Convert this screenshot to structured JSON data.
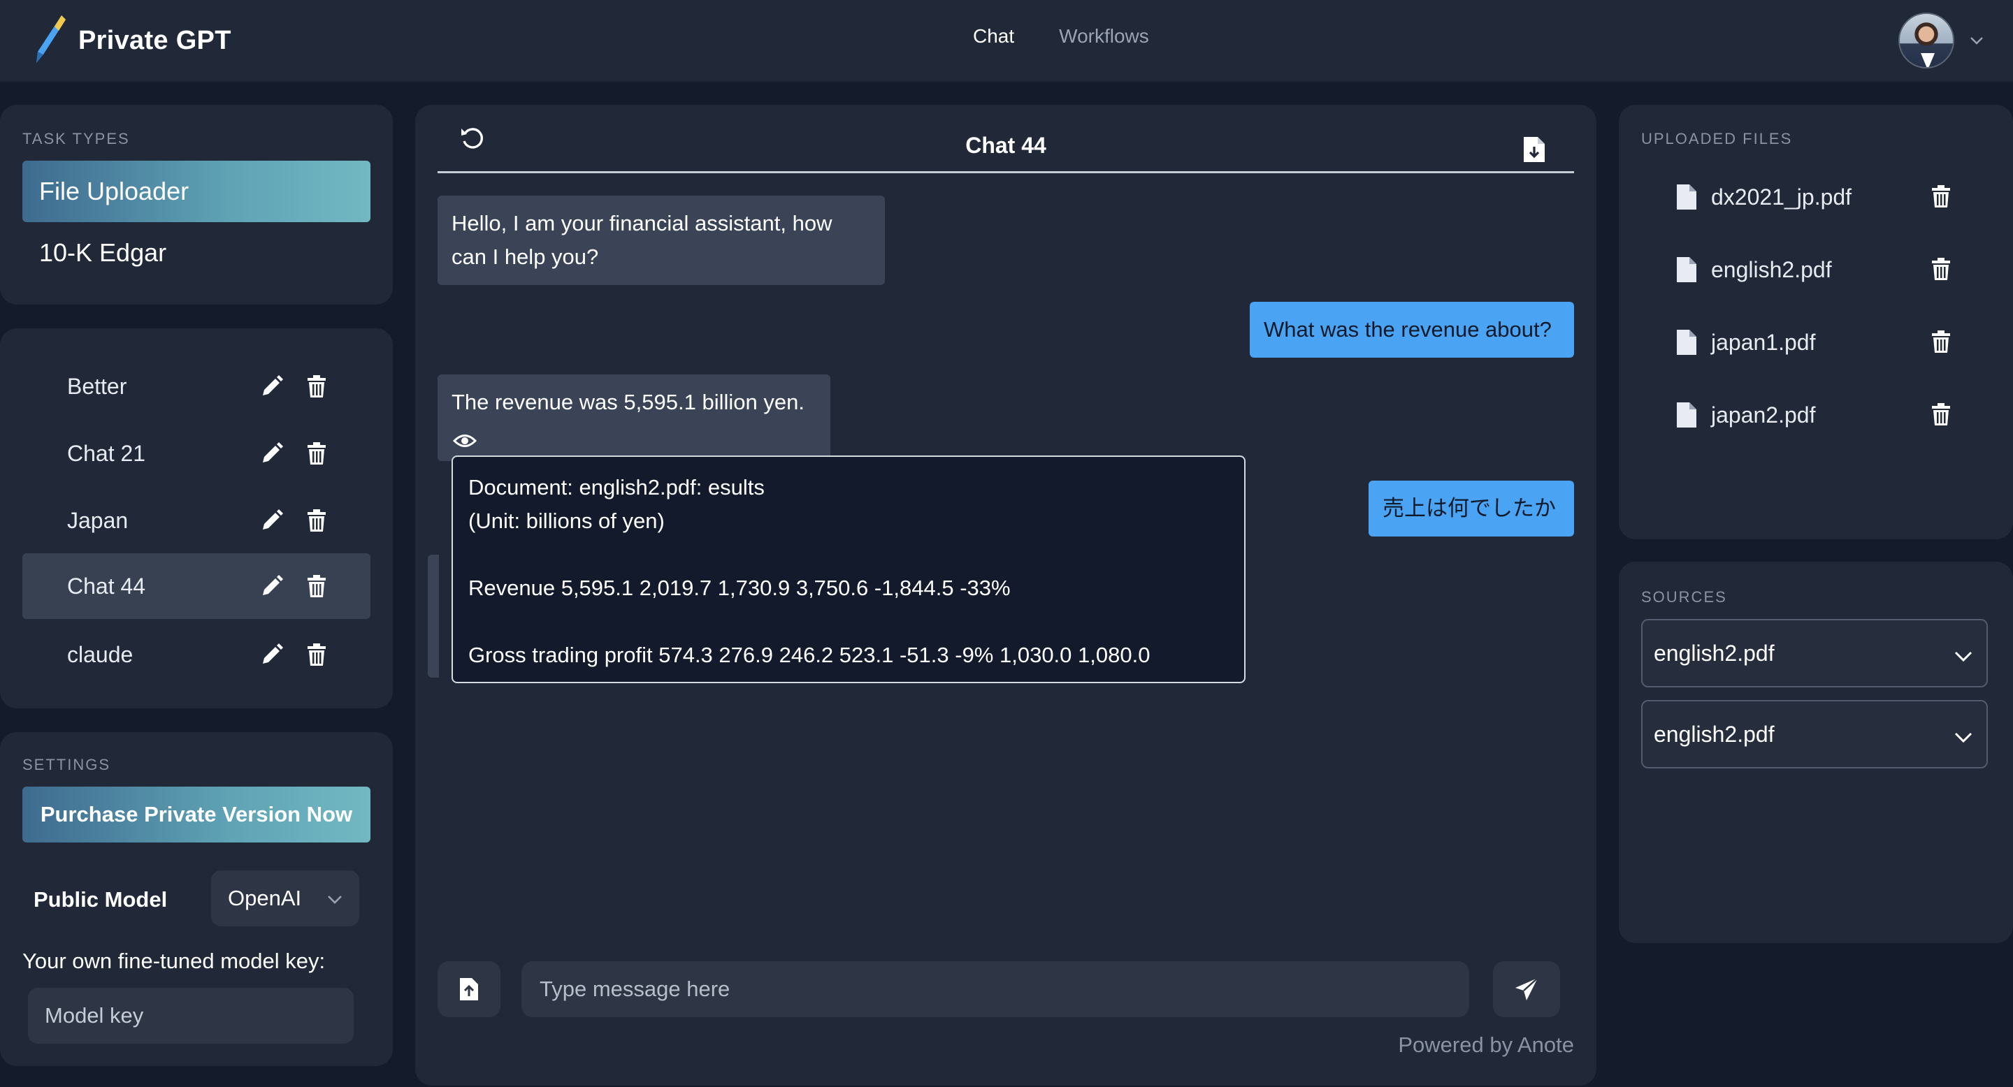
{
  "app": {
    "name": "Private GPT"
  },
  "nav": {
    "items": [
      {
        "label": "Chat",
        "active": true
      },
      {
        "label": "Workflows",
        "active": false
      }
    ]
  },
  "task_types": {
    "title": "TASK TYPES",
    "items": [
      {
        "label": "File Uploader",
        "active": true
      },
      {
        "label": "10-K Edgar",
        "active": false
      }
    ]
  },
  "chats": {
    "items": [
      {
        "label": "Better"
      },
      {
        "label": "Chat 21"
      },
      {
        "label": "Japan"
      },
      {
        "label": "Chat 44",
        "active": true
      },
      {
        "label": "claude"
      }
    ]
  },
  "settings": {
    "title": "SETTINGS",
    "purchase_label": "Purchase Private Version Now",
    "public_model_label": "Public Model",
    "public_model_value": "OpenAI",
    "finetune_label": "Your own fine-tuned model key:",
    "model_key_placeholder": "Model key"
  },
  "chat": {
    "title": "Chat 44",
    "messages": [
      {
        "role": "bot",
        "text_line1": "Hello, I am your financial assistant, how",
        "text_line2": "can I help you?"
      },
      {
        "role": "user",
        "text": "What was the revenue about?"
      },
      {
        "role": "bot",
        "text": "The revenue was 5,595.1 billion yen."
      },
      {
        "role": "user",
        "text": "売上は何でしたか"
      }
    ],
    "source_popup": {
      "line1": "Document: english2.pdf: esults",
      "line2": "(Unit: billions of yen)",
      "line3": "Revenue 5,595.1 2,019.7 1,730.9 3,750.6 -1,844.5 -33%",
      "line4": "Gross trading profit 574.3 276.9 246.2 523.1 -51.3 -9% 1,030.0 1,080.0"
    },
    "input_placeholder": "Type message here",
    "powered_by": "Powered by Anote"
  },
  "uploaded_files": {
    "title": "UPLOADED FILES",
    "items": [
      {
        "name": "dx2021_jp.pdf"
      },
      {
        "name": "english2.pdf"
      },
      {
        "name": "japan1.pdf"
      },
      {
        "name": "japan2.pdf"
      }
    ]
  },
  "sources": {
    "title": "SOURCES",
    "selects": [
      {
        "value": "english2.pdf"
      },
      {
        "value": "english2.pdf"
      }
    ]
  },
  "colors": {
    "accent_blue": "#4aa3f3",
    "background": "#141b2b",
    "panel": "#212938",
    "gradient_start": "#3e6b8f",
    "gradient_end": "#72b8c2"
  }
}
